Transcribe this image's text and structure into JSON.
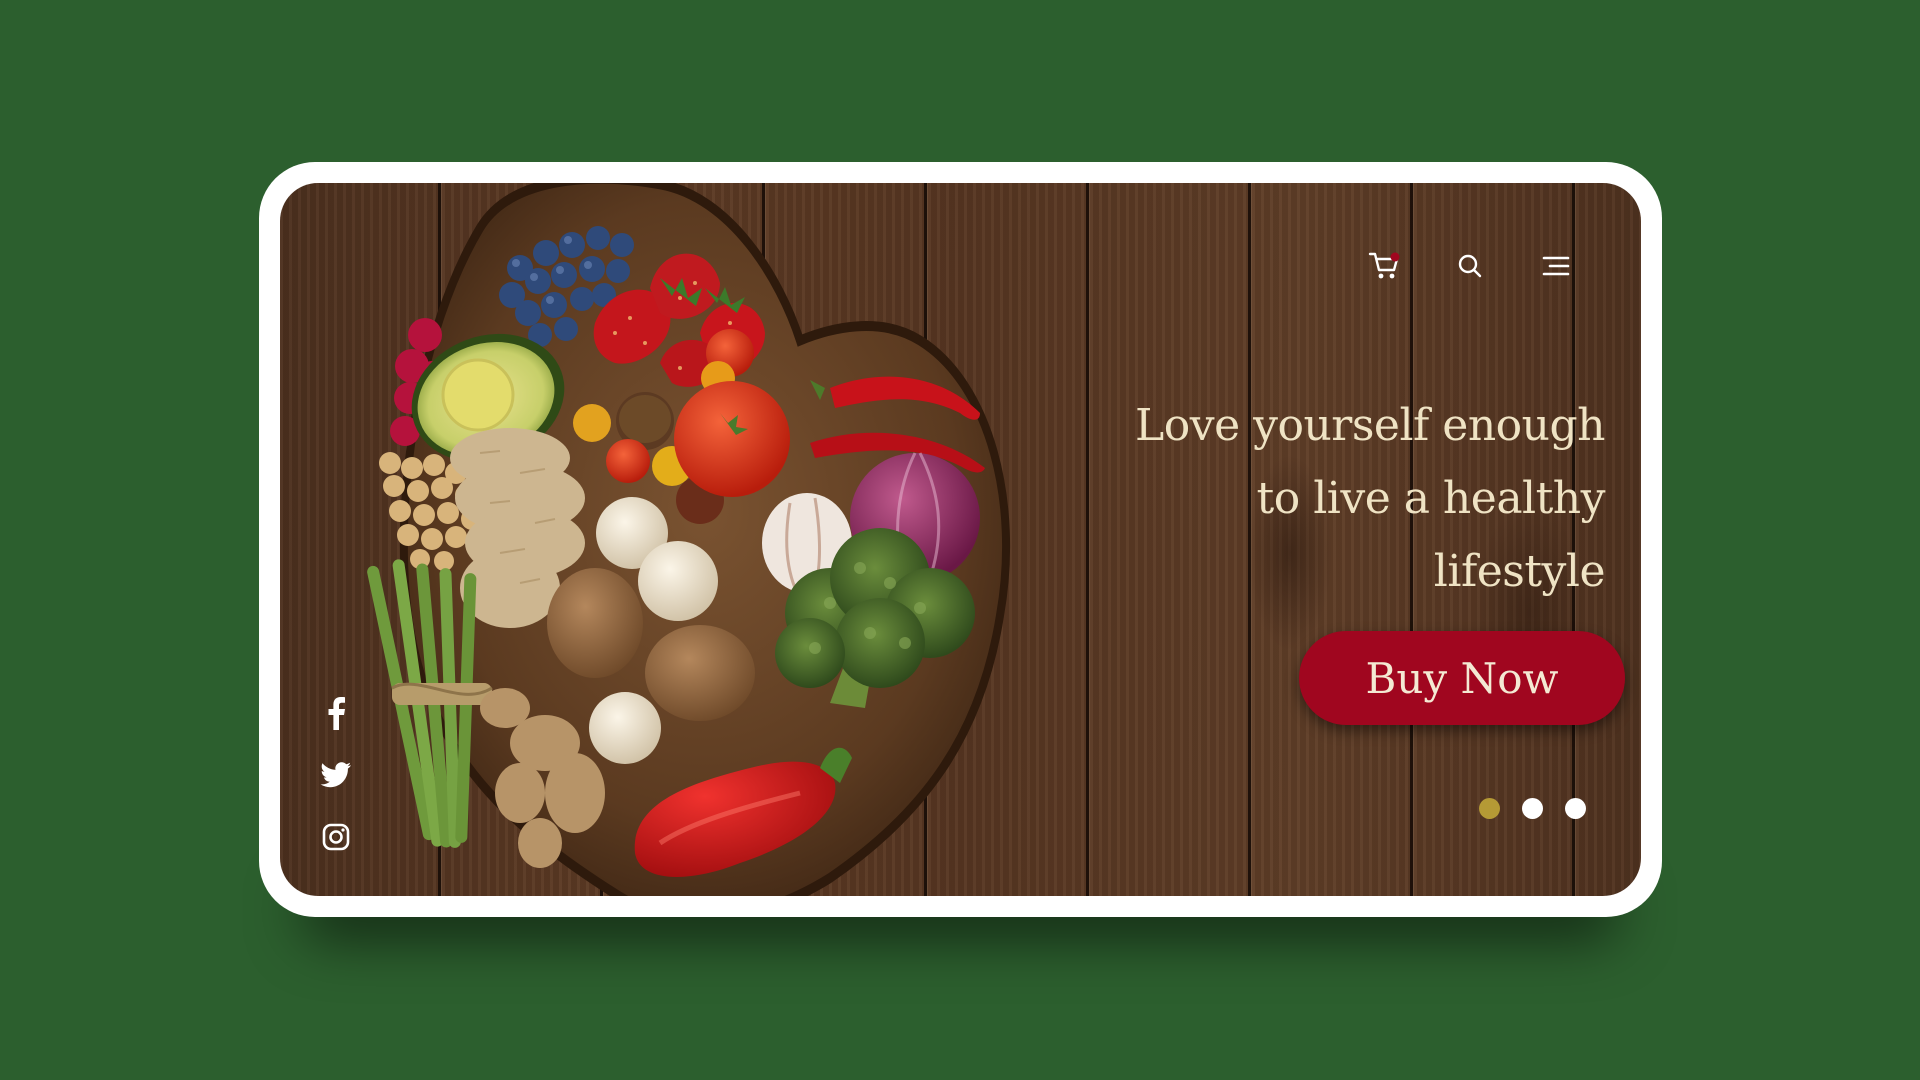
{
  "hero": {
    "headline_lines": [
      "Love yourself enough",
      "to live a healthy",
      "lifestyle"
    ],
    "cta_label": "Buy Now",
    "image_subject": "heart-shaped wooden board with fruits and vegetables"
  },
  "nav": {
    "icons": [
      "cart-icon",
      "search-icon",
      "menu-icon"
    ],
    "cart_has_badge": true
  },
  "social": {
    "icons": [
      "facebook-icon",
      "twitter-icon",
      "instagram-icon"
    ]
  },
  "slider": {
    "count": 3,
    "active_index": 0
  },
  "colors": {
    "background": "#2c5f2e",
    "frame": "#ffffff",
    "cta": "#a0061f",
    "headline_text": "#efe3c4",
    "dot_active": "#b59a35",
    "dot_inactive": "#ffffff",
    "cart_badge": "#a0061f"
  }
}
